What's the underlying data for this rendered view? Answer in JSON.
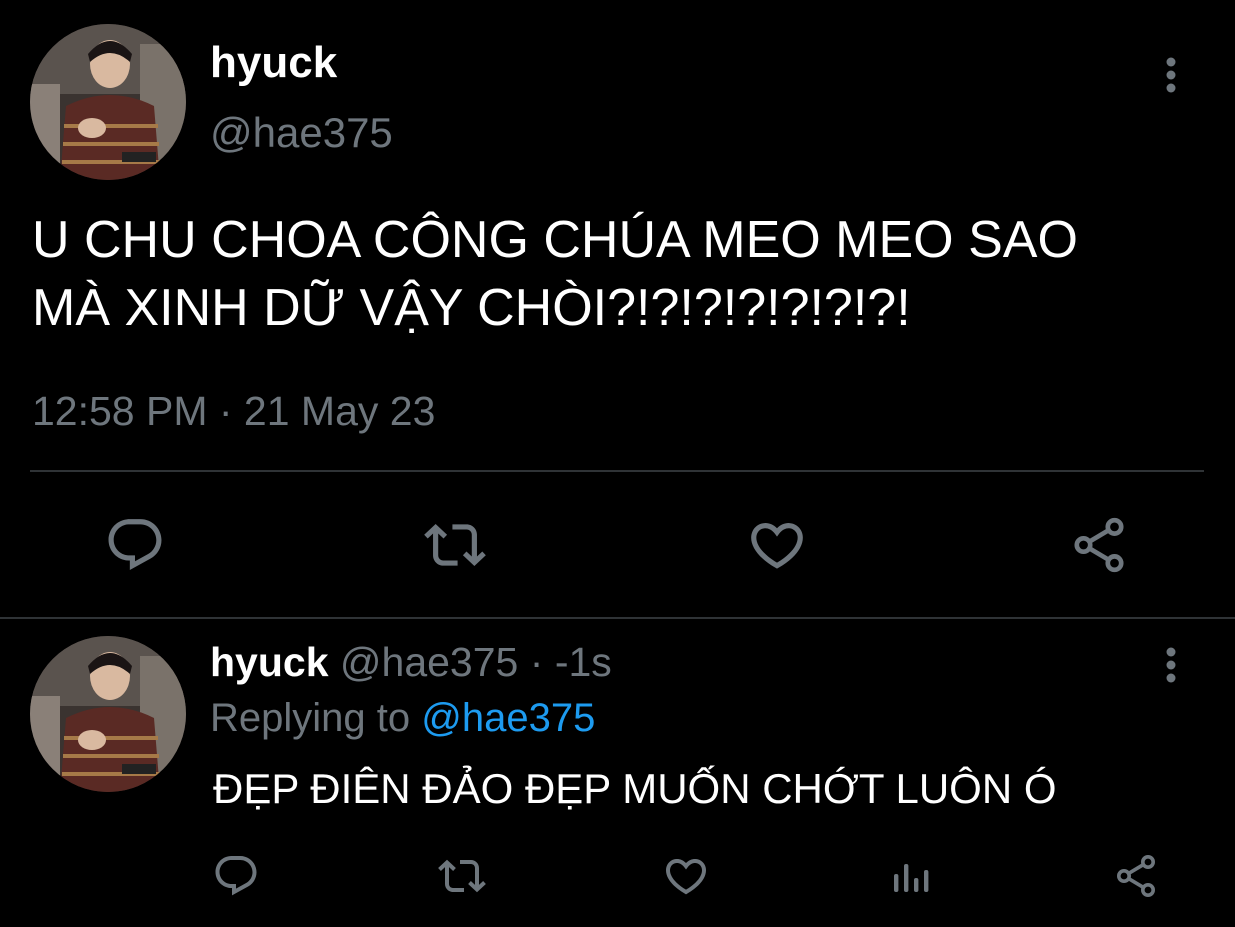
{
  "main_tweet": {
    "display_name": "hyuck",
    "handle": "@hae375",
    "text_line1": "U CHU CHOA CÔNG CHÚA MEO MEO SAO",
    "text_line2": "MÀ XINH DỮ VẬY CHÒI?!?!?!?!?!?!?!",
    "timestamp": "12:58 PM · 21 May 23",
    "actions": [
      "reply-icon",
      "retweet-icon",
      "like-icon",
      "share-icon"
    ]
  },
  "reply_tweet": {
    "display_name": "hyuck",
    "handle": "@hae375",
    "separator": "·",
    "time": "-1s",
    "replying_prefix": "Replying to",
    "replying_handle": "@hae375",
    "text": "ĐẸP ĐIÊN ĐẢO ĐẸP MUỐN CHỚT LUÔN Ó",
    "actions": [
      "reply-icon",
      "retweet-icon",
      "like-icon",
      "analytics-icon",
      "share-icon"
    ]
  },
  "colors": {
    "background": "#000000",
    "primary_text": "#ffffff",
    "secondary_text": "#6e767d",
    "link": "#1d9bf0",
    "divider": "#2f3336"
  }
}
